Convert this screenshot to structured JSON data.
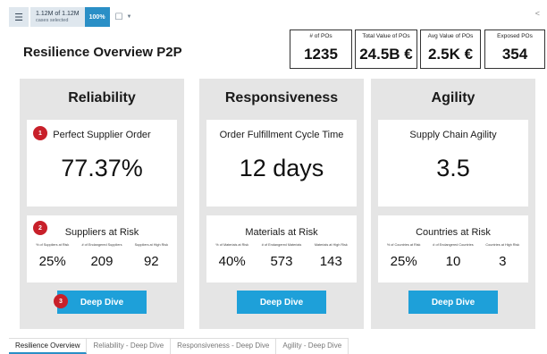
{
  "toolbar": {
    "cases_count": "1.12M of 1.12M",
    "cases_label": "cases selected",
    "percent": "100%",
    "menu_icon": "hamburger-icon",
    "bookmark_icon": "bookmark-icon",
    "share_icon": "share-icon"
  },
  "page_title": "Resilience Overview P2P",
  "kpis": [
    {
      "label": "# of POs",
      "value": "1235"
    },
    {
      "label": "Total Value of POs",
      "value": "24.5B €"
    },
    {
      "label": "Avg Value of POs",
      "value": "2.5K €"
    },
    {
      "label": "Exposed POs",
      "value": "354"
    }
  ],
  "panels": [
    {
      "title": "Reliability",
      "card1_title": "Perfect Supplier Order",
      "card1_value": "77.37%",
      "card2_title": "Suppliers at Risk",
      "sub": [
        {
          "label": "% of Suppliers at Risk",
          "value": "25%"
        },
        {
          "label": "# of Endangered Suppliers",
          "value": "209"
        },
        {
          "label": "Suppliers at High Risk",
          "value": "92"
        }
      ],
      "button": "Deep Dive"
    },
    {
      "title": "Responsiveness",
      "card1_title": "Order Fulfillment Cycle Time",
      "card1_value": "12 days",
      "card2_title": "Materials at Risk",
      "sub": [
        {
          "label": "% of Materials at Risk",
          "value": "40%"
        },
        {
          "label": "# of Endangered Materials",
          "value": "573"
        },
        {
          "label": "Materials at High Risk",
          "value": "143"
        }
      ],
      "button": "Deep Dive"
    },
    {
      "title": "Agility",
      "card1_title": "Supply Chain Agility",
      "card1_value": "3.5",
      "card2_title": "Countries at Risk",
      "sub": [
        {
          "label": "% of Countries at Risk",
          "value": "25%"
        },
        {
          "label": "# of Endangered Countries",
          "value": "10"
        },
        {
          "label": "Countries at High Risk",
          "value": "3"
        }
      ],
      "button": "Deep Dive"
    }
  ],
  "badges": [
    "1",
    "2",
    "3"
  ],
  "tabs": [
    "Resilience Overview",
    "Reliability - Deep Dive",
    "Responsiveness - Deep Dive",
    "Agility - Deep Dive"
  ],
  "colors": {
    "accent": "#1ea0d9",
    "badge": "#c8202a",
    "panel_bg": "#e5e5e5"
  }
}
